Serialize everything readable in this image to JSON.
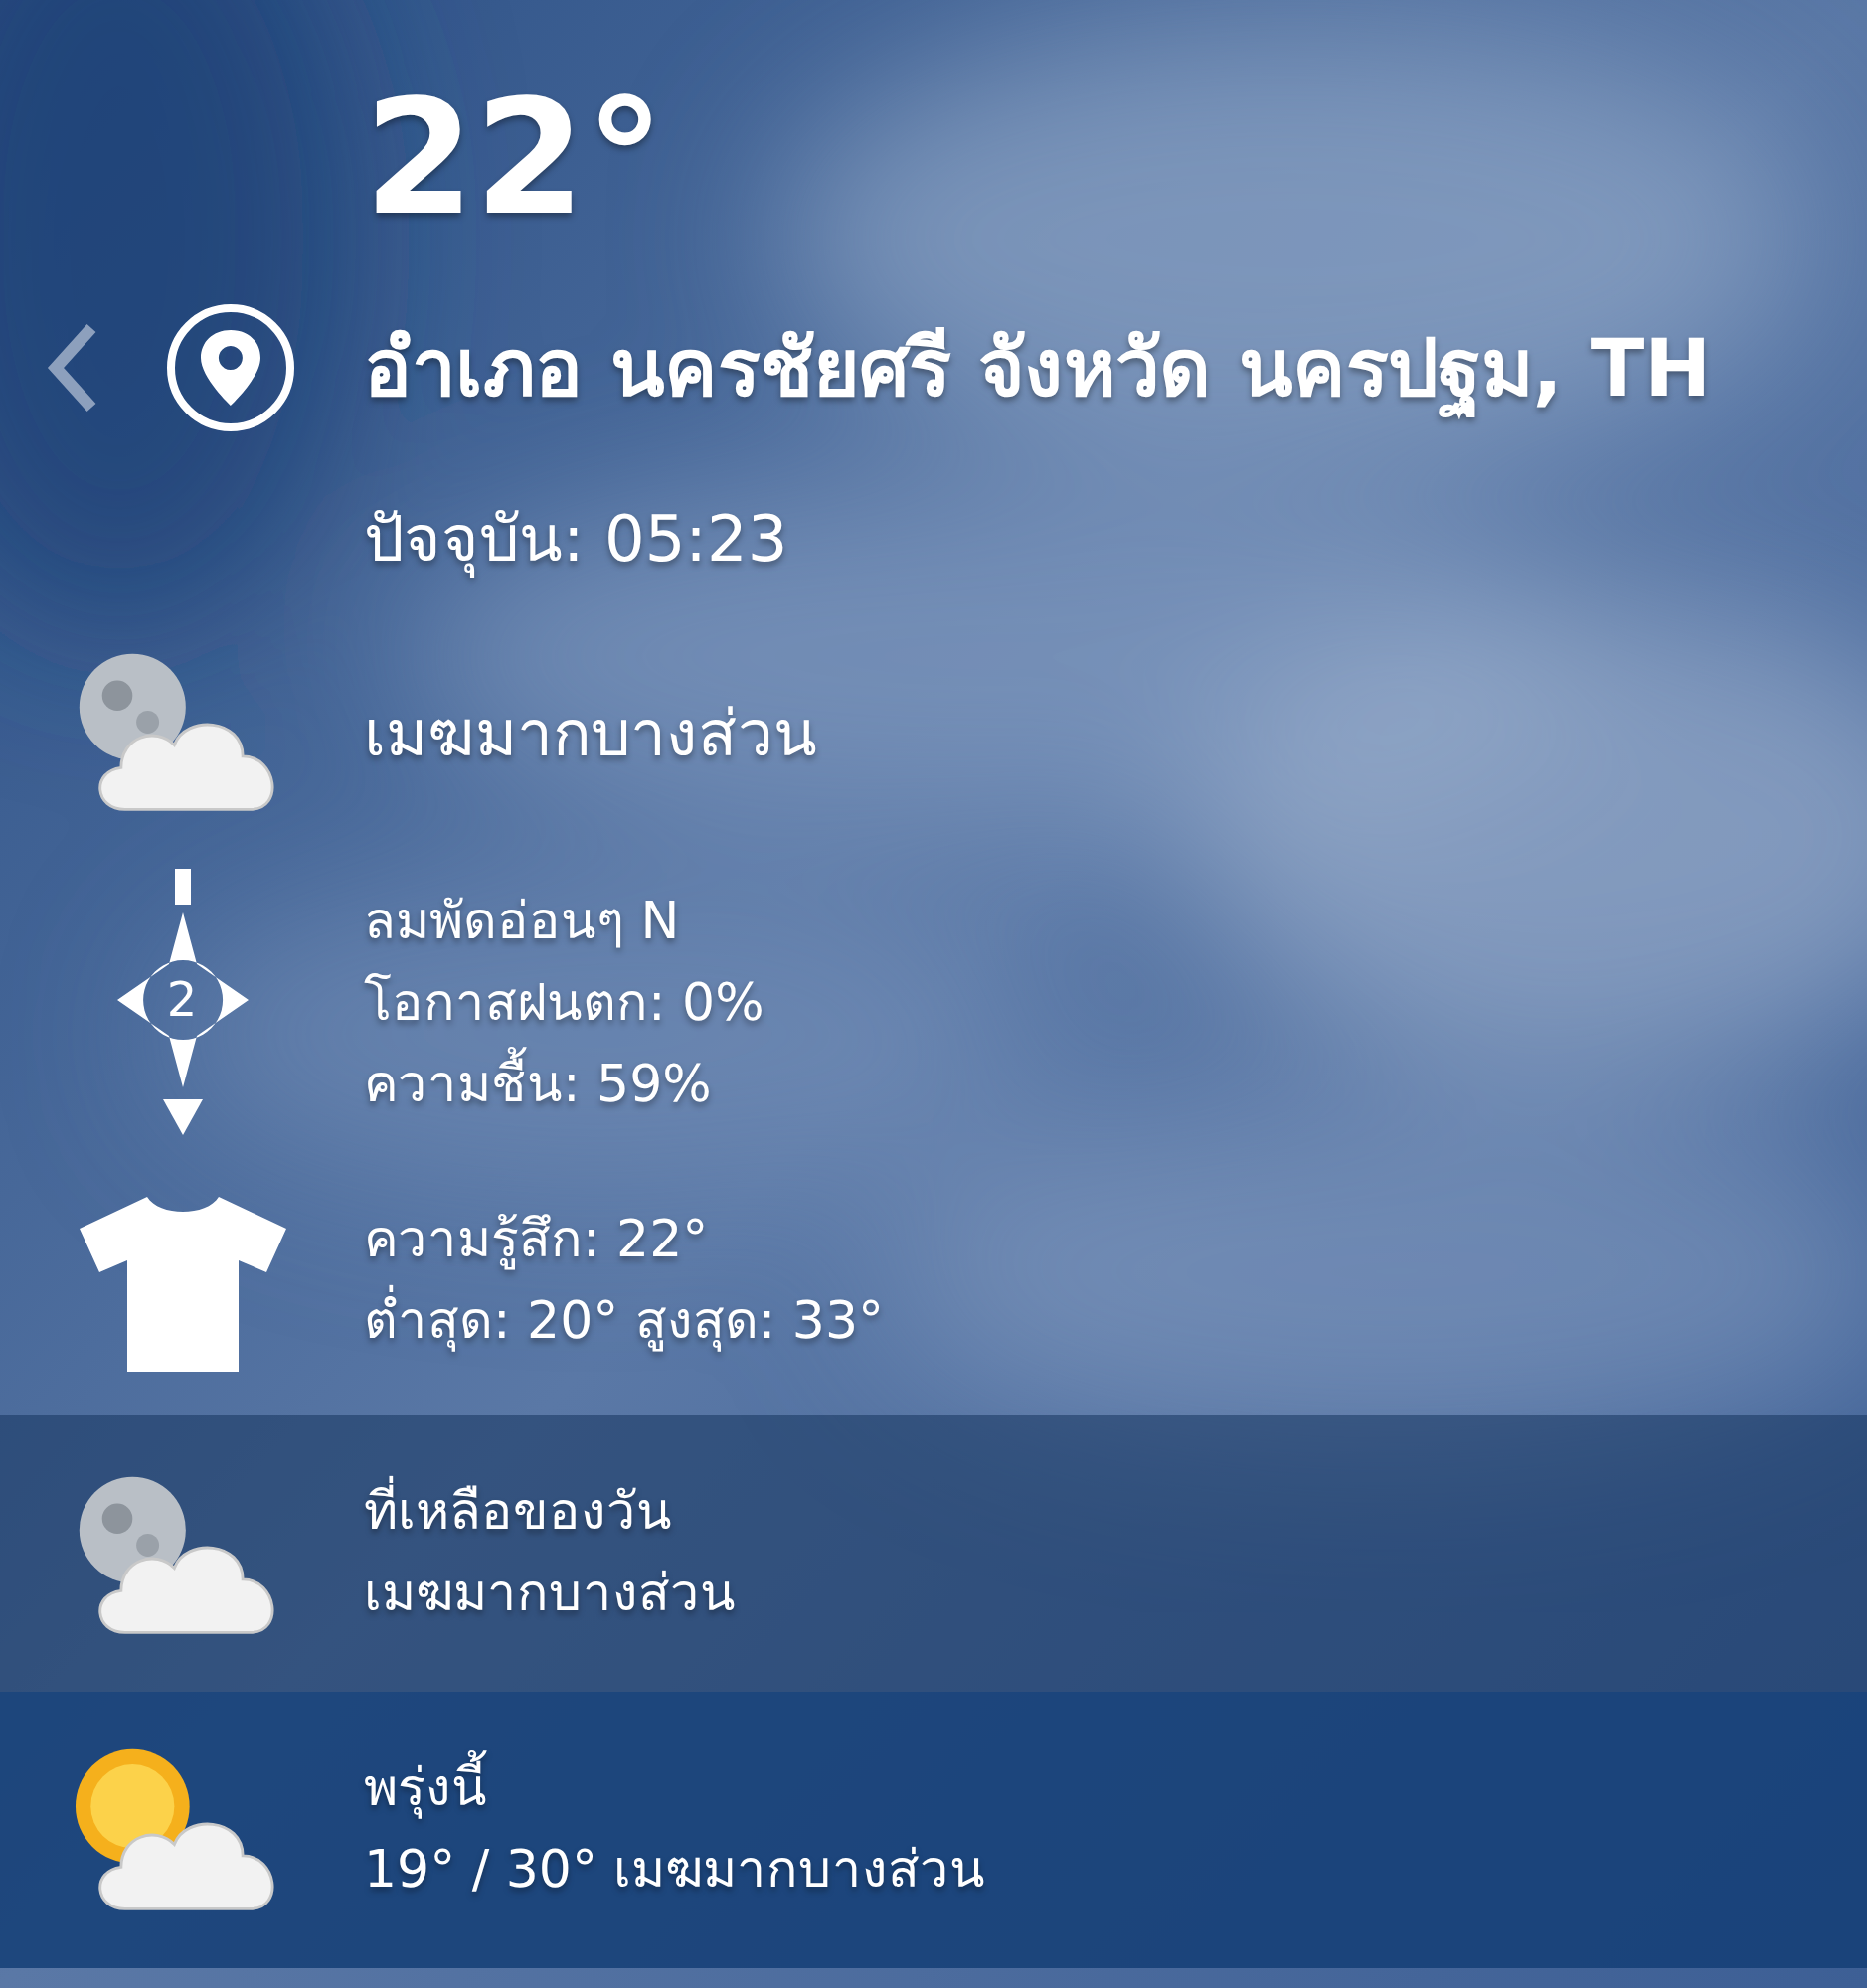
{
  "temperature": "22°",
  "location": {
    "name": "อำเภอ นครชัยศรี จังหวัด นครปฐม, TH"
  },
  "current_time": "ปัจจุบัน: 05:23",
  "condition": {
    "kind": "moon-cloud",
    "text": "เมฆมากบางส่วน"
  },
  "wind": {
    "speed": "2",
    "lines": [
      "ลมพัดอ่อนๆ N",
      "โอกาสฝนตก: 0%",
      "ความชื้น: 59%"
    ]
  },
  "feels": {
    "lines": [
      "ความรู้สึก: 22°",
      "ต่ำสุด: 20° สูงสุด: 33°"
    ]
  },
  "forecast": [
    {
      "kind": "moon-cloud",
      "title": "ที่เหลือของวัน",
      "summary": "เมฆมากบางส่วน"
    },
    {
      "kind": "sun-cloud",
      "title": "พรุ่งนี้",
      "summary": "19° / 30° เมฆมากบางส่วน"
    }
  ]
}
